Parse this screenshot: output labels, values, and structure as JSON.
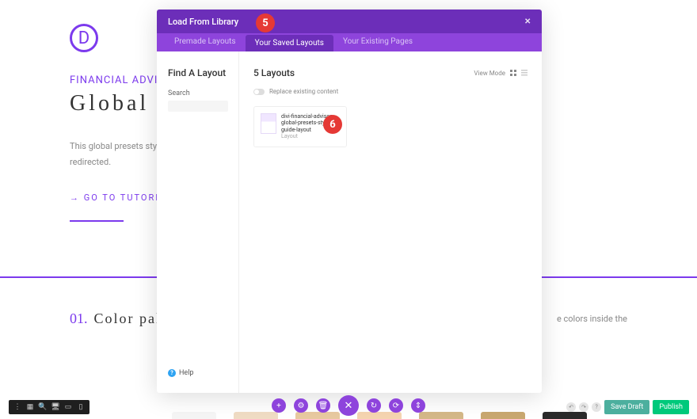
{
  "page": {
    "logo_letter": "D",
    "subtitle": "Financial Advisor Layo",
    "title": "Global Prese",
    "description": "This global presets style guide is a modules into global presets? For a below to be redirected.",
    "goto_link": "→ GO TO TUTORIAL",
    "section_num": "01.",
    "section_label": "Color palette",
    "side_text": "e colors inside the"
  },
  "modal": {
    "header_title": "Load From Library",
    "tabs": {
      "premade": "Premade Layouts",
      "saved": "Your Saved Layouts",
      "existing": "Your Existing Pages"
    },
    "left": {
      "title": "Find A Layout",
      "search_label": "Search",
      "help": "Help"
    },
    "right": {
      "title": "5 Layouts",
      "view_mode": "View Mode",
      "replace_label": "Replace existing content",
      "layout_card": {
        "name": "divi-financial-advisor-global-presets-style-guide-layout",
        "type": "Layout"
      }
    }
  },
  "annotations": {
    "a5": "5",
    "a6": "6"
  },
  "right_toolbar": {
    "save_draft": "Save Draft",
    "publish": "Publish"
  },
  "swatch_colors": [
    "#f5f5f5",
    "#f0dcc4",
    "#e8c9a0",
    "#f5d4b0",
    "#d4b888",
    "#c9a870",
    "#2a2a2a"
  ]
}
